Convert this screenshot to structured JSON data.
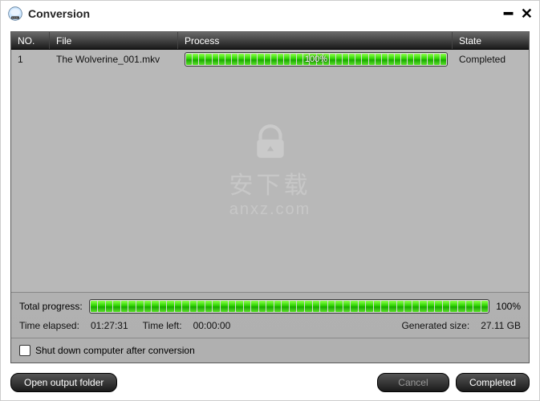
{
  "window": {
    "title": "Conversion"
  },
  "table": {
    "headers": {
      "no": "NO.",
      "file": "File",
      "process": "Process",
      "state": "State"
    },
    "rows": [
      {
        "no": "1",
        "file": "The Wolverine_001.mkv",
        "progress_label": "100%",
        "progress_pct": 100,
        "state": "Completed"
      }
    ]
  },
  "total": {
    "label": "Total progress:",
    "pct_label": "100%",
    "pct": 100
  },
  "timeinfo": {
    "elapsed_label": "Time elapsed:",
    "elapsed_value": "01:27:31",
    "left_label": "Time left:",
    "left_value": "00:00:00",
    "gen_label": "Generated size:",
    "gen_value": "27.11 GB"
  },
  "shutdown": {
    "label": "Shut down computer after conversion",
    "checked": false
  },
  "footer": {
    "open_folder": "Open output folder",
    "cancel": "Cancel",
    "completed": "Completed"
  },
  "watermark": {
    "line1": "安下载",
    "line2": "anxz.com"
  }
}
